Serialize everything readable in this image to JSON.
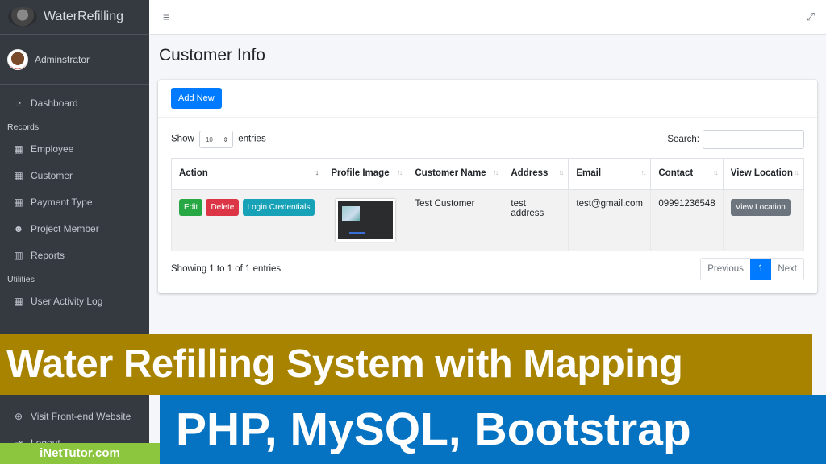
{
  "app": {
    "brand": "WaterRefilling",
    "user": "Adminstrator"
  },
  "sidebar": {
    "items": [
      {
        "label": "Dashboard",
        "icon": "tachometer-icon",
        "glyph": "◔"
      },
      {
        "header": "Records"
      },
      {
        "label": "Employee",
        "icon": "building-icon",
        "glyph": "▦"
      },
      {
        "label": "Customer",
        "icon": "building-icon",
        "glyph": "▦"
      },
      {
        "label": "Payment Type",
        "icon": "building-icon",
        "glyph": "▦"
      },
      {
        "label": "Project Member",
        "icon": "users-icon",
        "glyph": "☻"
      },
      {
        "label": "Reports",
        "icon": "chart-icon",
        "glyph": "▥"
      },
      {
        "header": "Utilities"
      },
      {
        "label": "User Activity Log",
        "icon": "building-icon",
        "glyph": "▦"
      }
    ],
    "bottom": [
      {
        "label": "Visit Front-end Website",
        "icon": "globe-icon",
        "glyph": "⊕"
      },
      {
        "label": "Logout",
        "icon": "sign-out-icon",
        "glyph": "⇥"
      }
    ]
  },
  "topbar": {
    "menu_glyph": "≡",
    "expand_glyph": "⤢"
  },
  "page": {
    "title": "Customer Info",
    "add_new": "Add New"
  },
  "datatable": {
    "show_label": "Show",
    "entries_label": "entries",
    "page_length": "10",
    "search_label": "Search:",
    "search_value": "",
    "columns": [
      "Action",
      "Profile Image",
      "Customer Name",
      "Address",
      "Email",
      "Contact",
      "View Location"
    ],
    "sort_glyph": "↑↓",
    "rows": [
      {
        "actions": {
          "edit": "Edit",
          "delete": "Delete",
          "login": "Login Credentials"
        },
        "customer_name": "Test Customer",
        "address": "test address",
        "email": "test@gmail.com",
        "contact": "09991236548",
        "view_location": "View Location"
      }
    ],
    "info": "Showing 1 to 1 of 1 entries",
    "pagination": {
      "previous": "Previous",
      "current": "1",
      "next": "Next"
    }
  },
  "banners": {
    "title": "Water Refilling System with Mapping",
    "subtitle": "PHP, MySQL, Bootstrap",
    "site": "iNetTutor.com"
  }
}
